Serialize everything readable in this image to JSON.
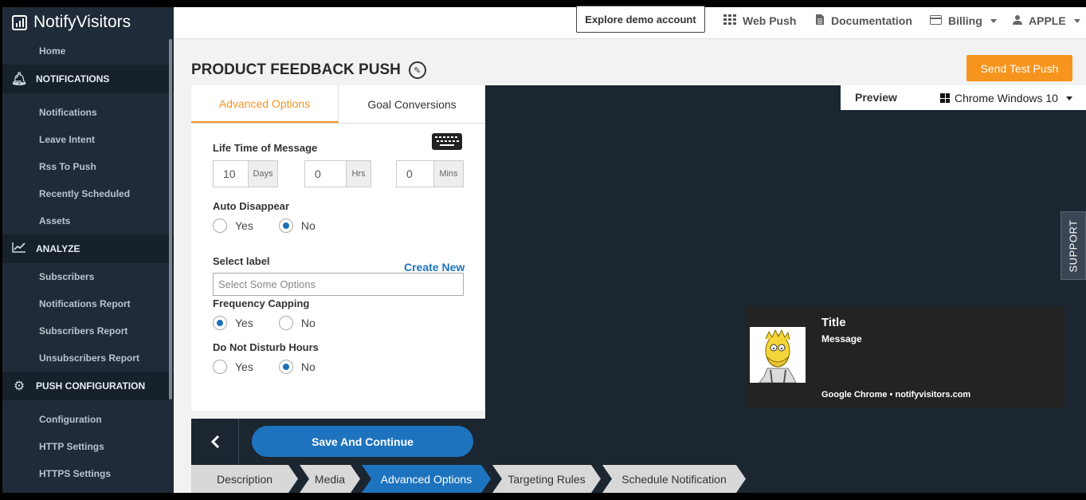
{
  "app": {
    "name": "NotifyVisitors"
  },
  "sidebar": {
    "home": "Home",
    "sections": [
      {
        "title": "NOTIFICATIONS",
        "icon": "bell-icon",
        "items": [
          "Notifications",
          "Leave Intent",
          "Rss To Push",
          "Recently Scheduled",
          "Assets"
        ]
      },
      {
        "title": "ANALYZE",
        "icon": "chart-line-icon",
        "items": [
          "Subscribers",
          "Notifications Report",
          "Subscribers Report",
          "Unsubscribers Report"
        ]
      },
      {
        "title": "PUSH CONFIGURATION",
        "icon": "gear-icon",
        "items": [
          "Configuration",
          "HTTP Settings",
          "HTTPS Settings"
        ]
      }
    ]
  },
  "topbar": {
    "explore": "Explore demo account",
    "web_push": "Web Push",
    "documentation": "Documentation",
    "billing": "Billing",
    "account": "APPLE"
  },
  "page": {
    "title": "PRODUCT FEEDBACK PUSH",
    "send_test": "Send Test Push"
  },
  "tabs": [
    "Advanced Options",
    "Goal Conversions"
  ],
  "form": {
    "lifetime_label": "Life Time of Message",
    "lifetime": [
      {
        "value": "10",
        "unit": "Days"
      },
      {
        "value": "0",
        "unit": "Hrs"
      },
      {
        "value": "0",
        "unit": "Mins"
      }
    ],
    "auto_disappear_label": "Auto Disappear",
    "auto_disappear": "No",
    "select_label": "Select label",
    "create_new": "Create New",
    "select_placeholder": "Select Some Options",
    "frequency_label": "Frequency Capping",
    "frequency": "Yes",
    "dnd_label": "Do Not Disturb Hours",
    "dnd": "No",
    "yes": "Yes",
    "no": "No"
  },
  "footer": {
    "save": "Save And Continue"
  },
  "preview": {
    "label": "Preview",
    "os": "Chrome Windows 10",
    "support": "SUPPORT",
    "notification": {
      "title": "Title",
      "message": "Message",
      "source": "Google Chrome • notifyvisitors.com"
    }
  },
  "steps": [
    "Description",
    "Media",
    "Advanced Options",
    "Targeting Rules",
    "Schedule Notification"
  ],
  "active_step": 2,
  "colors": {
    "accent": "#f7941d",
    "primary": "#1e73be",
    "sidebar": "#1f2b38"
  }
}
